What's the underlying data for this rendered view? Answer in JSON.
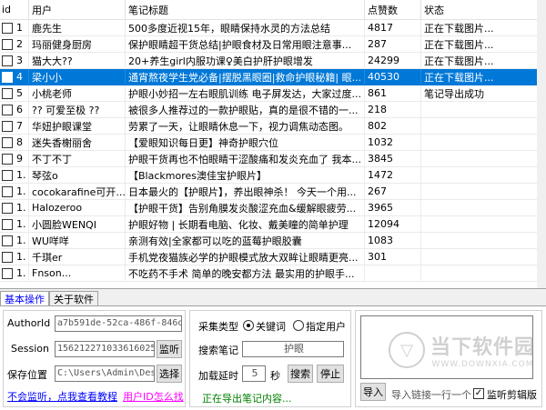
{
  "grid": {
    "headers": [
      "id",
      "用户",
      "笔记标题",
      "点赞数",
      "状态"
    ],
    "rows": [
      {
        "id": "1",
        "user": "鹿先生",
        "title": "500多度近视15年，眼睛保持水灵的方法总结",
        "likes": "4817",
        "status": "正在下载图片..."
      },
      {
        "id": "2",
        "user": "玛丽健身厨房",
        "title": "保护眼睛超干货总结|护眼食材及日常用眼注意事...",
        "likes": "287",
        "status": "正在下载图片..."
      },
      {
        "id": "3",
        "user": "猫大大??",
        "title": "20+养生girl内服功课♀美白护肝护眼增发",
        "likes": "24299",
        "status": "正在下载图片..."
      },
      {
        "id": "4",
        "user": "梁小小",
        "title": "通宵熬夜学生党必备|摆脱黑眼圈|救命护眼秘籍|  眼...",
        "likes": "40530",
        "status": "正在下载图片..."
      },
      {
        "id": "5",
        "user": "小桃老师",
        "title": "护眼小妙招一左右眼肌训练 电子屏发达，大家过度...",
        "likes": "861",
        "status": "笔记导出成功"
      },
      {
        "id": "6",
        "user": "?? 可爱至极 ??",
        "title": "被很多人推荐过的一款护眼贴，真的是很不错的一...",
        "likes": "218",
        "status": ""
      },
      {
        "id": "7",
        "user": "华妞护眼课堂",
        "title": "劳累了一天，让眼睛休息一下，视力调焦动态图。",
        "likes": "802",
        "status": ""
      },
      {
        "id": "8",
        "user": "迷失香榭丽舍",
        "title": "【爱眼知识每日更】神奇护眼穴位",
        "likes": "1032",
        "status": ""
      },
      {
        "id": "9",
        "user": "不丁不丁",
        "title": "护眼干货再也不怕眼睛干涩酸痛和发炎充血了 我本...",
        "likes": "3845",
        "status": ""
      },
      {
        "id": "1.",
        "user": "琴弦o",
        "title": "【Blackmores澳佳宝护眼片】",
        "likes": "1472",
        "status": ""
      },
      {
        "id": "1.",
        "user": "cocokarafine可开...",
        "title": "日本最火的【护眼片】，养出眼神杀！  今天一个用...",
        "likes": "267",
        "status": ""
      },
      {
        "id": "1.",
        "user": "Halozeroo",
        "title": "【护眼干货】告别角膜发炎酸涩充血&缓解眼疲劳...",
        "likes": "3965",
        "status": ""
      },
      {
        "id": "1.",
        "user": "小圆脸WENQI",
        "title": "护眼好物 | 长期看电脑、化妆、戴美瞳的简单护理",
        "likes": "12094",
        "status": ""
      },
      {
        "id": "1.",
        "user": "WU咩咩",
        "title": "亲测有效|全家都可以吃的蓝莓护眼胶囊",
        "likes": "1083",
        "status": ""
      },
      {
        "id": "1.",
        "user": "千琪er",
        "title": "手机党夜猫族必学的护眼模式放大双眸让眼睛更亮...",
        "likes": "301",
        "status": ""
      },
      {
        "id": "1.",
        "user": "Fnson...",
        "title": "不吃药不手术 简单的晚安都方法 最实用的护眼手...",
        "likes": "",
        "status": ""
      }
    ]
  },
  "tabs": {
    "basic": "基本操作",
    "about": "关于软件"
  },
  "left": {
    "authid_label": "AuthorId",
    "authid_value": "a7b591de-52ca-486f-846d-e7",
    "session_label": "Session",
    "session_value": "1562122710336160253б",
    "listen_button": "监听",
    "save_label": "保存位置",
    "save_value": "C:\\Users\\Admin\\Deskt",
    "choose_button": "选择",
    "help_link": "不会监听，点我查看教程",
    "userid_link": "用户ID怎么找"
  },
  "middle": {
    "type_label": "采集类型",
    "opt_keyword": "关键词",
    "opt_user": "指定用户",
    "search_label": "搜索笔记",
    "search_value": "护眼",
    "delay_label": "加载延时",
    "delay_value": "5",
    "delay_unit": "秒",
    "search_button": "搜索",
    "stop_button": "停止",
    "status_text": "正在导出笔记内容..."
  },
  "right": {
    "import_button": "导入",
    "import_hint": "导入链接一行一个",
    "clipboard_label": "监听剪辑版",
    "clipboard_checked": true
  },
  "watermark": {
    "text": "当下软件园",
    "url": "WWW.DOWNXIA.COM"
  }
}
